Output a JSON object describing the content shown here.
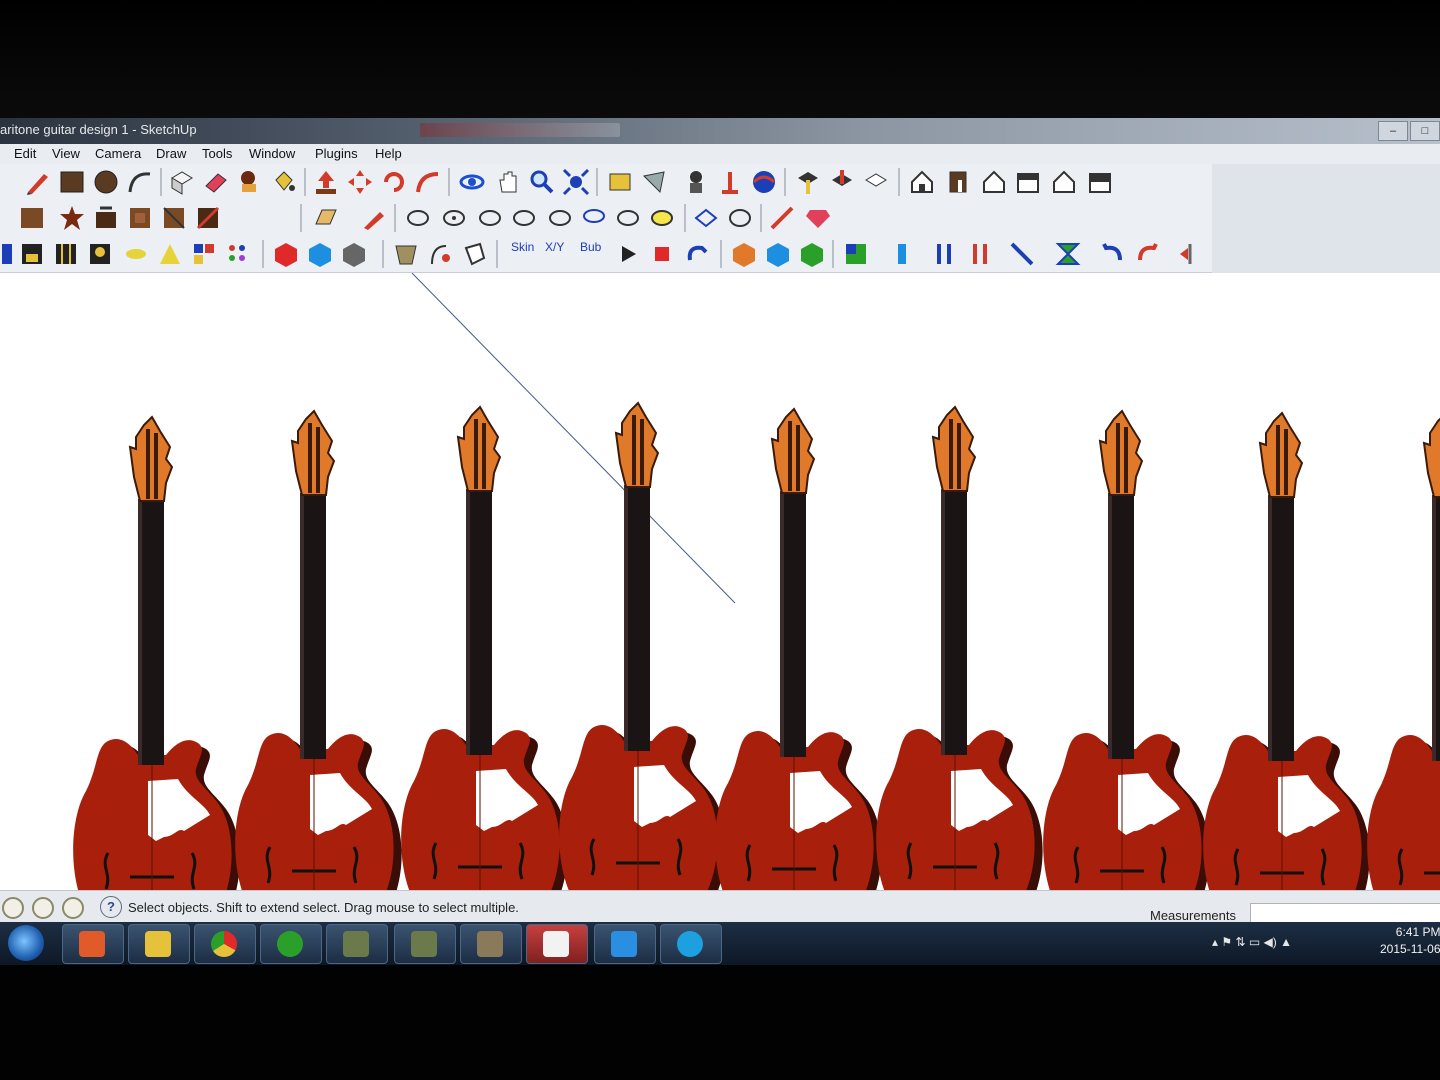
{
  "window": {
    "title": "aritone guitar design 1 - SketchUp",
    "controls": [
      "–",
      "□"
    ]
  },
  "menu": [
    "Edit",
    "View",
    "Camera",
    "Draw",
    "Tools",
    "Window",
    "Plugins",
    "Help"
  ],
  "toolbar": {
    "text_tools": [
      "Skin",
      "X/Y",
      "Bub"
    ]
  },
  "status": {
    "message": "Select objects. Shift to extend select. Drag mouse to select multiple.",
    "measurements_label": "Measurements",
    "measurements_value": ""
  },
  "clock": {
    "time": "6:41 PM",
    "date": "2015-11-06"
  },
  "model": {
    "guitar_count": 9,
    "colors": {
      "body": "#a81f0c",
      "body_shadow": "#3a0d06",
      "neck": "#1b1414",
      "headstock": "#e07a2a",
      "pickguard": "#ffffff"
    }
  }
}
